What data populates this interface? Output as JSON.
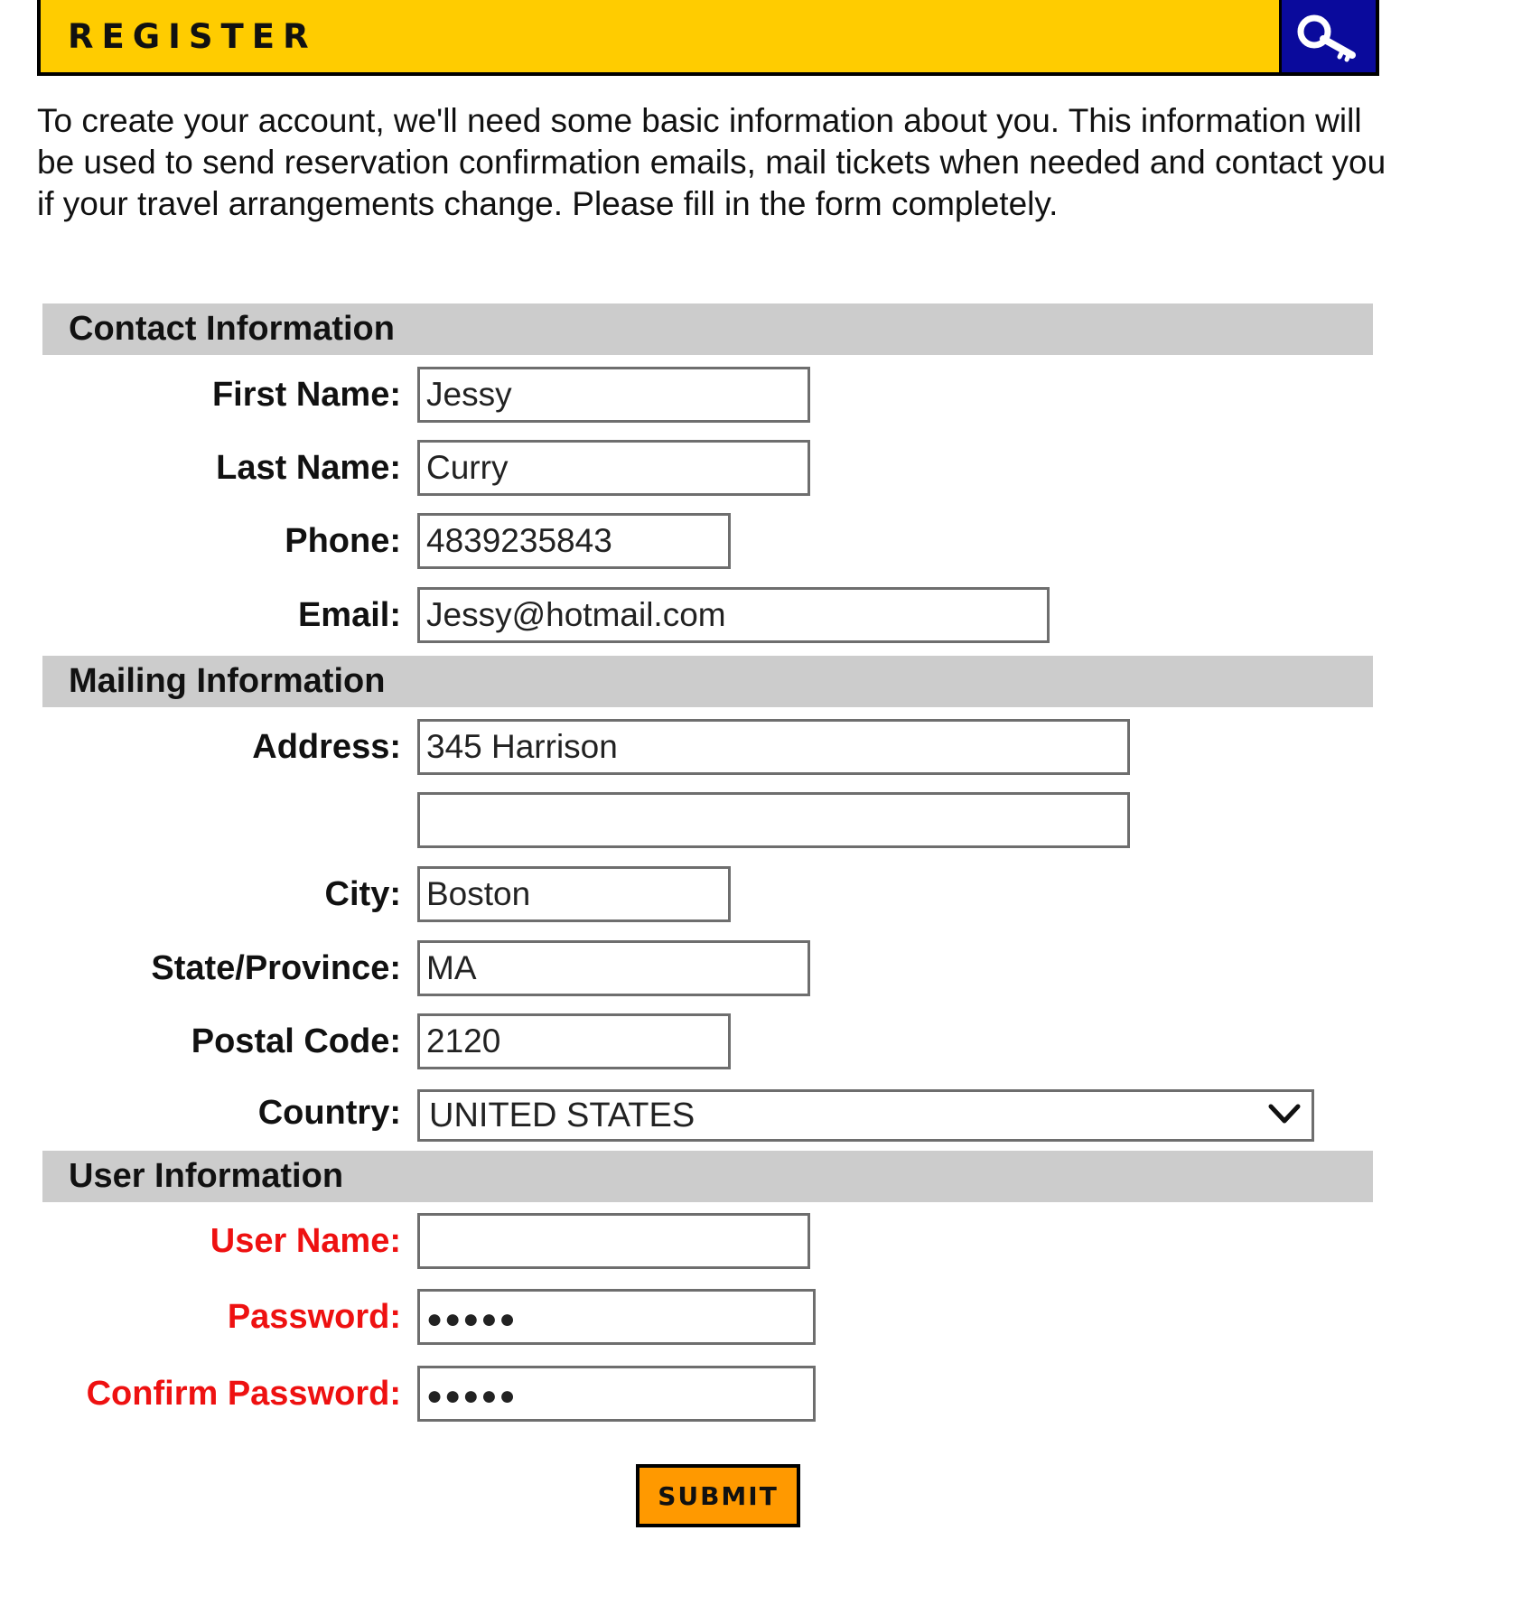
{
  "header": {
    "title": "REGISTER",
    "icon": "key-search-icon",
    "bg_color": "#ffcc00",
    "icon_bg_color": "#0a0a9c"
  },
  "intro": "To create your account, we'll need some basic information about you. This information will be used to send reservation confirmation emails, mail tickets when needed and contact you if your travel arrangements change. Please fill in the form completely.",
  "sections": {
    "contact": "Contact Information",
    "mailing": "Mailing Information",
    "user": "User Information"
  },
  "contact": {
    "first_name_label": "First Name:",
    "first_name_value": "Jessy",
    "last_name_label": "Last Name:",
    "last_name_value": "Curry",
    "phone_label": "Phone:",
    "phone_value": "4839235843",
    "email_label": "Email:",
    "email_value": "Jessy@hotmail.com"
  },
  "mailing": {
    "address_label": "Address:",
    "address1_value": "345 Harrison",
    "address2_value": "",
    "city_label": "City:",
    "city_value": "Boston",
    "state_label": "State/Province:",
    "state_value": "MA",
    "postal_label": "Postal Code:",
    "postal_value": "2120",
    "country_label": "Country:",
    "country_value": "UNITED STATES"
  },
  "user": {
    "username_label": "User Name:",
    "username_value": "",
    "password_label": "Password:",
    "password_value": "●●●●●",
    "confirm_label": "Confirm Password:",
    "confirm_value": "●●●●●",
    "required_color": "#ee1111"
  },
  "submit_label": "SUBMIT",
  "submit_color": "#ff9900"
}
